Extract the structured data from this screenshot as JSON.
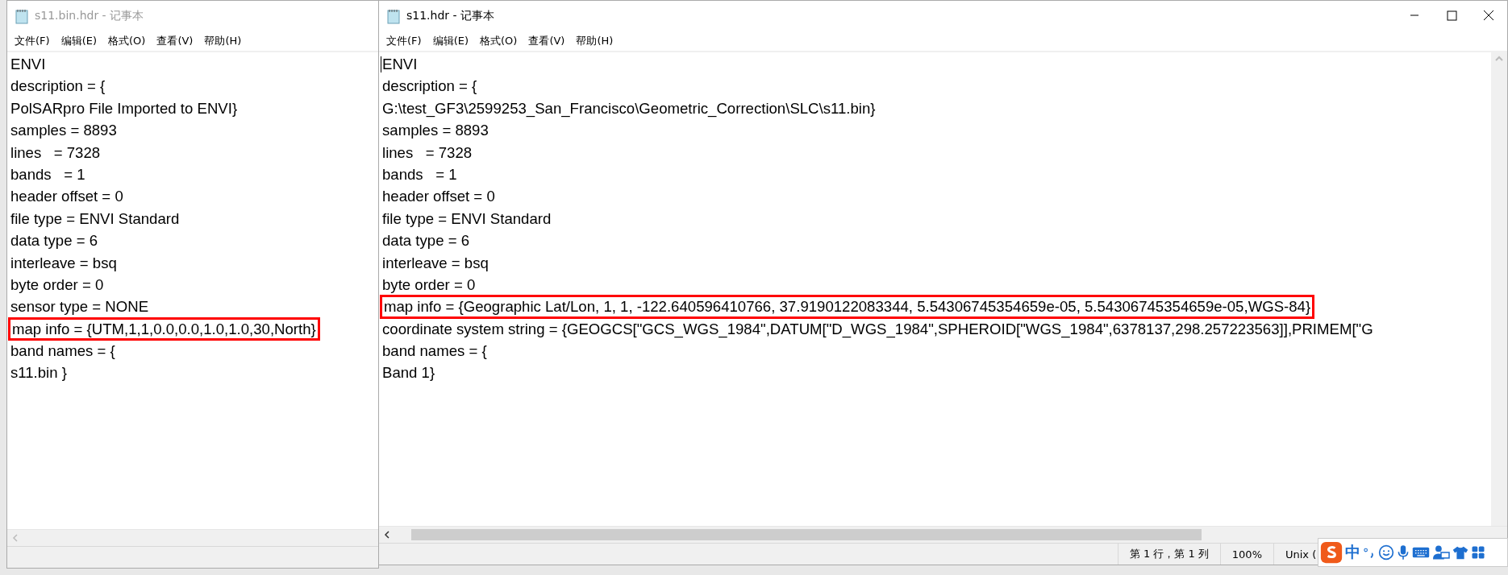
{
  "windows": [
    {
      "title": "s11.bin.hdr - 记事本",
      "active": false,
      "menu": [
        "文件(F)",
        "编辑(E)",
        "格式(O)",
        "查看(V)",
        "帮助(H)"
      ],
      "lines": [
        {
          "text": "ENVI",
          "highlighted": false
        },
        {
          "text": "description = {",
          "highlighted": false
        },
        {
          "text": "PolSARpro File Imported to ENVI}",
          "highlighted": false
        },
        {
          "text": "samples = 8893",
          "highlighted": false
        },
        {
          "text": "lines   = 7328",
          "highlighted": false
        },
        {
          "text": "bands   = 1",
          "highlighted": false
        },
        {
          "text": "header offset = 0",
          "highlighted": false
        },
        {
          "text": "file type = ENVI Standard",
          "highlighted": false
        },
        {
          "text": "data type = 6",
          "highlighted": false
        },
        {
          "text": "interleave = bsq",
          "highlighted": false
        },
        {
          "text": "byte order = 0",
          "highlighted": false
        },
        {
          "text": "sensor type = NONE",
          "highlighted": false
        },
        {
          "text": "map info = {UTM,1,1,0.0,0.0,1.0,1.0,30,North}",
          "highlighted": true
        },
        {
          "text": "band names = {",
          "highlighted": false
        },
        {
          "text": "s11.bin }",
          "highlighted": false
        }
      ]
    },
    {
      "title": "s11.hdr - 记事本",
      "active": true,
      "menu": [
        "文件(F)",
        "编辑(E)",
        "格式(O)",
        "查看(V)",
        "帮助(H)"
      ],
      "lines": [
        {
          "text": "ENVI",
          "highlighted": false
        },
        {
          "text": "description = {",
          "highlighted": false
        },
        {
          "text": "G:\\test_GF3\\2599253_San_Francisco\\Geometric_Correction\\SLC\\s11.bin}",
          "highlighted": false
        },
        {
          "text": "samples = 8893",
          "highlighted": false
        },
        {
          "text": "lines   = 7328",
          "highlighted": false
        },
        {
          "text": "bands   = 1",
          "highlighted": false
        },
        {
          "text": "header offset = 0",
          "highlighted": false
        },
        {
          "text": "file type = ENVI Standard",
          "highlighted": false
        },
        {
          "text": "data type = 6",
          "highlighted": false
        },
        {
          "text": "interleave = bsq",
          "highlighted": false
        },
        {
          "text": "byte order = 0",
          "highlighted": false
        },
        {
          "text": "map info = {Geographic Lat/Lon, 1, 1, -122.640596410766, 37.9190122083344, 5.54306745354659e-05, 5.54306745354659e-05,WGS-84}",
          "highlighted": true
        },
        {
          "text": "coordinate system string = {GEOGCS[\"GCS_WGS_1984\",DATUM[\"D_WGS_1984\",SPHEROID[\"WGS_1984\",6378137,298.257223563]],PRIMEM[\"G",
          "highlighted": false
        },
        {
          "text": "band names = {",
          "highlighted": false
        },
        {
          "text": "Band 1}",
          "highlighted": false
        }
      ],
      "status_bar": [
        "第 1 行，第 1 列",
        "100%",
        "Unix ("
      ]
    }
  ],
  "ime_toolbar": {
    "mode": "中"
  }
}
